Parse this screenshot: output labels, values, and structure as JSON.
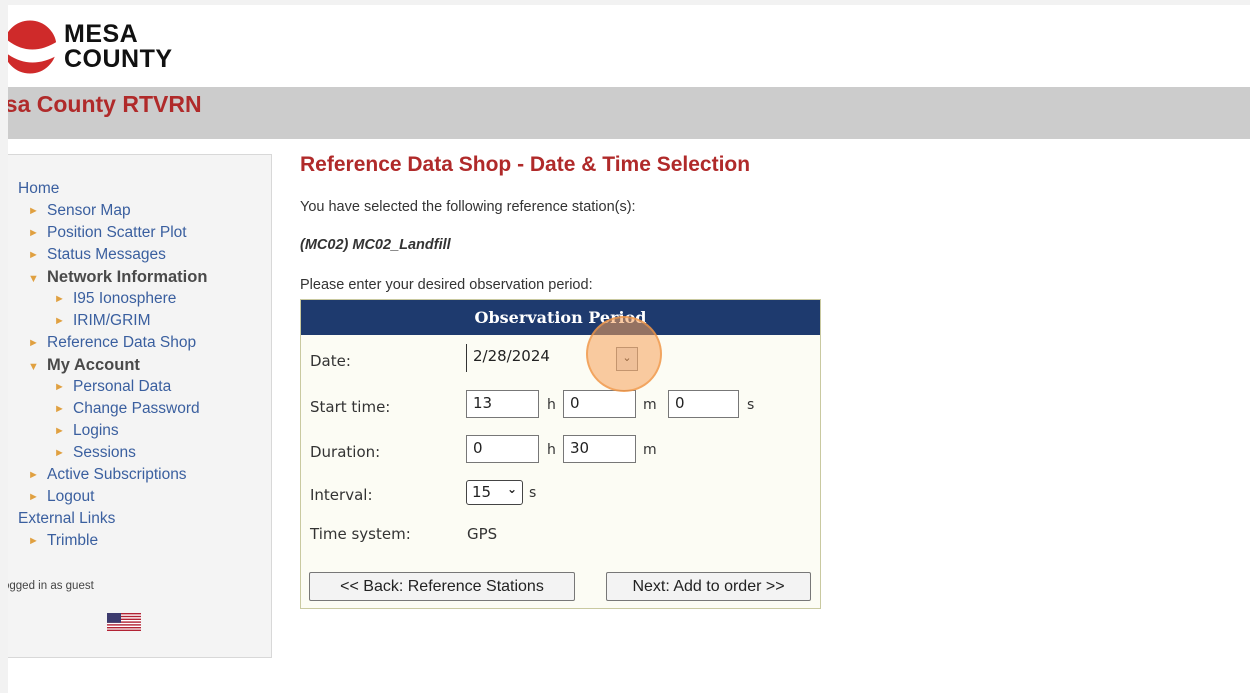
{
  "logo": {
    "line1": "MESA",
    "line2": "COUNTY"
  },
  "banner": {
    "title": "esa County RTVRN"
  },
  "sidebar": {
    "items": [
      {
        "label": "Home",
        "level": 0
      },
      {
        "label": "Sensor Map",
        "level": 1
      },
      {
        "label": "Position Scatter Plot",
        "level": 1
      },
      {
        "label": "Status Messages",
        "level": 1
      },
      {
        "label": "Network Information",
        "level": 1,
        "expanded": true
      },
      {
        "label": "I95 Ionosphere",
        "level": 2
      },
      {
        "label": "IRIM/GRIM",
        "level": 2
      },
      {
        "label": "Reference Data Shop",
        "level": 1
      },
      {
        "label": "My Account",
        "level": 1,
        "expanded": true
      },
      {
        "label": "Personal Data",
        "level": 2
      },
      {
        "label": "Change Password",
        "level": 2
      },
      {
        "label": "Logins",
        "level": 2
      },
      {
        "label": "Sessions",
        "level": 2
      },
      {
        "label": "Active Subscriptions",
        "level": 1
      },
      {
        "label": "Logout",
        "level": 1
      },
      {
        "label": "External Links",
        "level": 0
      },
      {
        "label": "Trimble",
        "level": 1
      }
    ],
    "logged_in": "ogged in as guest"
  },
  "main": {
    "title": "Reference Data Shop - Date & Time Selection",
    "selected_text": "You have selected the following reference station(s):",
    "station": "(MC02) MC02_Landfill",
    "period_prompt": "Please enter your desired observation period:",
    "panel": {
      "header": "Observation Period",
      "date_label": "Date:",
      "date_value": "2/28/2024",
      "start_label": "Start time:",
      "start_h": "13",
      "start_m": "0",
      "start_s": "0",
      "duration_label": "Duration:",
      "duration_h": "0",
      "duration_m": "30",
      "interval_label": "Interval:",
      "interval_value": "15",
      "time_system_label": "Time system:",
      "time_system_value": "GPS",
      "unit_h": "h",
      "unit_m": "m",
      "unit_s": "s",
      "back_button": "<< Back: Reference Stations",
      "next_button": "Next: Add to order >>"
    }
  },
  "colors": {
    "title_red": "#b02a2a",
    "nav_blue": "#3a5f9f",
    "panel_header": "#1e3a6e",
    "bullet": "#e0a040"
  }
}
